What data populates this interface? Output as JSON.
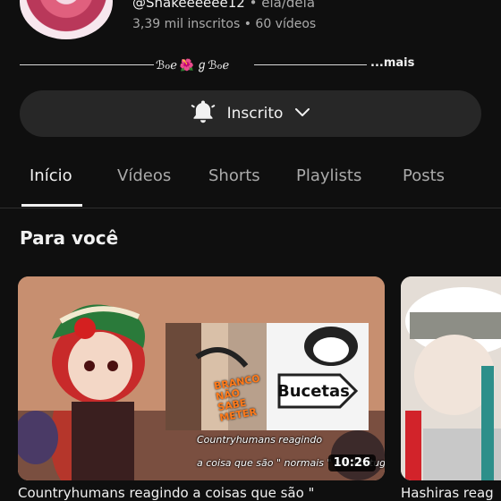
{
  "channel": {
    "handle": "@Shakeeeeee12",
    "pronouns": "ela/dela",
    "separator": "•",
    "subscribers": "3,39 mil inscritos",
    "videos": "60 vídeos",
    "bio_text": "ℬℴℯ 🌺 ℊℬℴℯ",
    "bio_more": "...mais"
  },
  "subscribe_button": {
    "label": "Inscrito",
    "icon": "bell-icon",
    "chevron": "chevron-down-icon"
  },
  "tabs": [
    {
      "label": "Início",
      "active": true
    },
    {
      "label": "Vídeos",
      "active": false
    },
    {
      "label": "Shorts",
      "active": false
    },
    {
      "label": "Playlists",
      "active": false
    },
    {
      "label": "Posts",
      "active": false
    }
  ],
  "section": {
    "title": "Para você"
  },
  "videos": [
    {
      "duration": "10:26",
      "thumb_text_1": "Countryhumans reagindo",
      "thumb_text_2": "a coisa que são \" normais \" em Portugal",
      "thumb_sign": "Bucetas",
      "thumb_meme": "BRANCO NÃO SABE METER",
      "title": "Countryhumans reagindo a coisas que são \""
    },
    {
      "title": "Hashiras reag"
    }
  ],
  "colors": {
    "background": "#0f0f0f",
    "button": "#272727",
    "text": "#f1f1f1",
    "muted": "#aaaaaa"
  }
}
